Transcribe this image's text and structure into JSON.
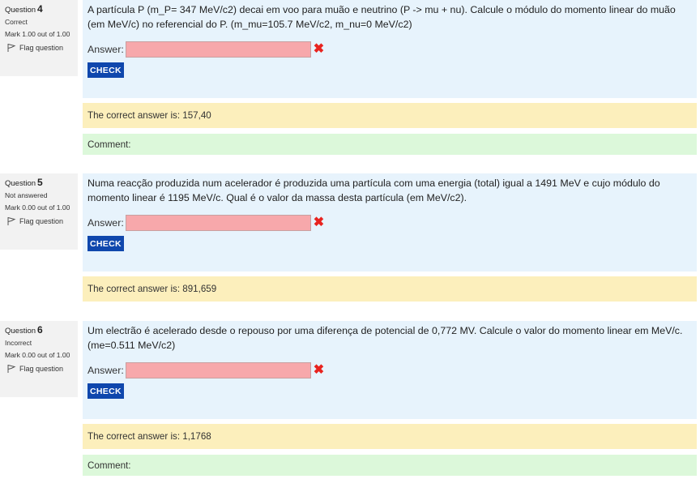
{
  "labels": {
    "question_prefix": "Question",
    "answer_label": "Answer:",
    "check_label": "CHECK",
    "flag_label": "Flag question",
    "comment_label": "Comment:",
    "wrong_mark": "✖"
  },
  "questions": [
    {
      "number": "4",
      "state": "Correct",
      "mark": "Mark 1.00 out of 1.00",
      "text": "A partícula P (m_P= 347 MeV/c2) decai em voo para muão e neutrino (P -> mu + nu). Calcule o módulo do momento linear do muão (em MeV/c) no referencial do P. (m_mu=105.7 MeV/c2, m_nu=0 MeV/c2)",
      "answer_value": "",
      "correct_answer": "The correct answer is: 157,40"
    },
    {
      "number": "5",
      "state": "Not answered",
      "mark": "Mark 0.00 out of 1.00",
      "text": "Numa reacção produzida num acelerador é produzida uma partícula com uma energia (total) igual a 1491 MeV e cujo módulo do momento linear é 1195 MeV/c. Qual é o valor da massa desta partícula (em MeV/c2).",
      "answer_value": "",
      "correct_answer": "The correct answer is: 891,659"
    },
    {
      "number": "6",
      "state": "Incorrect",
      "mark": "Mark 0.00 out of 1.00",
      "text": "Um electrão é acelerado desde o repouso por uma diferença de potencial de 0,772 MV. Calcule o valor do momento linear em MeV/c. (me=0.511 MeV/c2)",
      "answer_value": "",
      "correct_answer": "The correct answer is: 1,1768"
    }
  ],
  "colors": {
    "formulation_bg": "#e7f3fc",
    "outcome_bg": "#fcefbc",
    "comment_bg": "#dcf8da",
    "check_button": "#0f47ad",
    "incorrect_input": "#f7a8ab",
    "wrong_mark": "#e8231f"
  }
}
